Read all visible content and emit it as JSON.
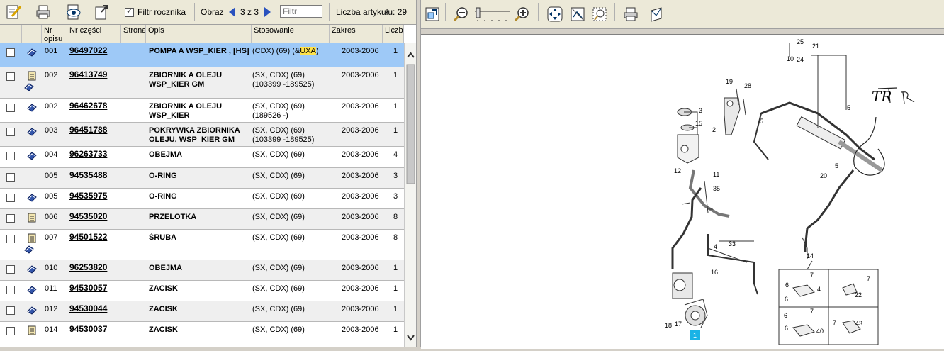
{
  "toolbar": {
    "filter_year_label": "Filtr rocznika",
    "filter_year_checked": true,
    "image_label": "Obraz",
    "image_pager": "3 z 3",
    "filter_placeholder": "Filtr",
    "count_label": "Liczba artykułu: 29"
  },
  "columns": {
    "nr_opisu": "Nr opisu",
    "nr_czesci": "Nr części",
    "strona": "Strona",
    "opis": "Opis",
    "stosowanie": "Stosowanie",
    "zakres": "Zakres",
    "liczba": "Liczb"
  },
  "rows": [
    {
      "nr": "001",
      "part": "96497022",
      "desc": "POMPA A WSP_KIER , [HS]",
      "stos_pre": "(CDX) (69) (&",
      "stos_hl": "UXA",
      "stos_post": ")",
      "zakres": "2003-2006",
      "qty": "1",
      "icons": [
        "book"
      ]
    },
    {
      "nr": "002",
      "part": "96413749",
      "desc": "ZBIORNIK A OLEJU WSP_KIER GM",
      "stos_pre": "(SX, CDX) (69) (103399 -189525)",
      "stos_hl": "",
      "stos_post": "",
      "zakres": "2003-2006",
      "qty": "1",
      "icons": [
        "scroll",
        "book"
      ]
    },
    {
      "nr": "002",
      "part": "96462678",
      "desc": "ZBIORNIK A OLEJU WSP_KIER",
      "stos_pre": "(SX, CDX) (69) (189526 -)",
      "stos_hl": "",
      "stos_post": "",
      "zakres": "2003-2006",
      "qty": "1",
      "icons": [
        "book"
      ]
    },
    {
      "nr": "003",
      "part": "96451788",
      "desc": "POKRYWKA ZBIORNIKA OLEJU, WSP_KIER GM",
      "stos_pre": "(SX, CDX) (69) (103399 -189525)",
      "stos_hl": "",
      "stos_post": "",
      "zakres": "2003-2006",
      "qty": "1",
      "icons": [
        "book"
      ]
    },
    {
      "nr": "004",
      "part": "96263733",
      "desc": "OBEJMA",
      "stos_pre": "(SX, CDX) (69)",
      "stos_hl": "",
      "stos_post": "",
      "zakres": "2003-2006",
      "qty": "4",
      "icons": [
        "book"
      ]
    },
    {
      "nr": "005",
      "part": "94535488",
      "desc": "O-RING",
      "stos_pre": "(SX, CDX) (69)",
      "stos_hl": "",
      "stos_post": "",
      "zakres": "2003-2006",
      "qty": "3",
      "icons": []
    },
    {
      "nr": "005",
      "part": "94535975",
      "desc": "O-RING",
      "stos_pre": "(SX, CDX) (69)",
      "stos_hl": "",
      "stos_post": "",
      "zakres": "2003-2006",
      "qty": "3",
      "icons": [
        "book"
      ]
    },
    {
      "nr": "006",
      "part": "94535020",
      "desc": "PRZELOTKA",
      "stos_pre": "(SX, CDX) (69)",
      "stos_hl": "",
      "stos_post": "",
      "zakres": "2003-2006",
      "qty": "8",
      "icons": [
        "scroll"
      ]
    },
    {
      "nr": "007",
      "part": "94501522",
      "desc": "ŚRUBA",
      "stos_pre": "(SX, CDX) (69)",
      "stos_hl": "",
      "stos_post": "",
      "zakres": "2003-2006",
      "qty": "8",
      "icons": [
        "scroll",
        "book"
      ]
    },
    {
      "nr": "010",
      "part": "96253820",
      "desc": "OBEJMA",
      "stos_pre": "(SX, CDX) (69)",
      "stos_hl": "",
      "stos_post": "",
      "zakres": "2003-2006",
      "qty": "1",
      "icons": [
        "book"
      ]
    },
    {
      "nr": "011",
      "part": "94530057",
      "desc": "ZACISK",
      "stos_pre": "(SX, CDX) (69)",
      "stos_hl": "",
      "stos_post": "",
      "zakres": "2003-2006",
      "qty": "1",
      "icons": [
        "book"
      ]
    },
    {
      "nr": "012",
      "part": "94530044",
      "desc": "ZACISK",
      "stos_pre": "(SX, CDX) (69)",
      "stos_hl": "",
      "stos_post": "",
      "zakres": "2003-2006",
      "qty": "1",
      "icons": [
        "book"
      ]
    },
    {
      "nr": "014",
      "part": "94530037",
      "desc": "ZACISK",
      "stos_pre": "(SX, CDX) (69)",
      "stos_hl": "",
      "stos_post": "",
      "zakres": "2003-2006",
      "qty": "1",
      "icons": [
        "scroll"
      ]
    }
  ],
  "diagram": {
    "callouts": [
      "25",
      "21",
      "10",
      "24",
      "19",
      "28",
      "3",
      "15",
      "2",
      "5",
      "5",
      "12",
      "11",
      "35",
      "20",
      "5",
      "33",
      "4",
      "14",
      "16",
      "18",
      "17",
      "1",
      "7",
      "6",
      "4",
      "6",
      "7",
      "22",
      "6",
      "7",
      "40",
      "6",
      "7",
      "43"
    ],
    "handwriting": "TR"
  }
}
